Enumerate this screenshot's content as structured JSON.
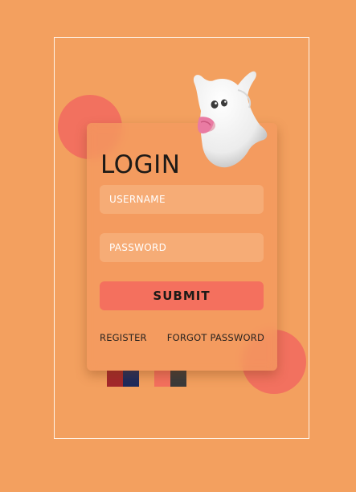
{
  "login": {
    "title": "LOGIN",
    "username_placeholder": "USERNAME",
    "password_placeholder": "PASSWORD",
    "submit_label": "SUBMIT",
    "register_label": "REGISTER",
    "forgot_label": "FORGOT PASSWORD"
  },
  "colors": {
    "background": "#f3a05f",
    "accent": "#f4705e",
    "blob": "#f2715f",
    "swatches": [
      "#a3282b",
      "#1d2a5c",
      "#f4705e",
      "#3a3a3a"
    ]
  },
  "icons": {
    "mascot": "ghost-icon"
  }
}
